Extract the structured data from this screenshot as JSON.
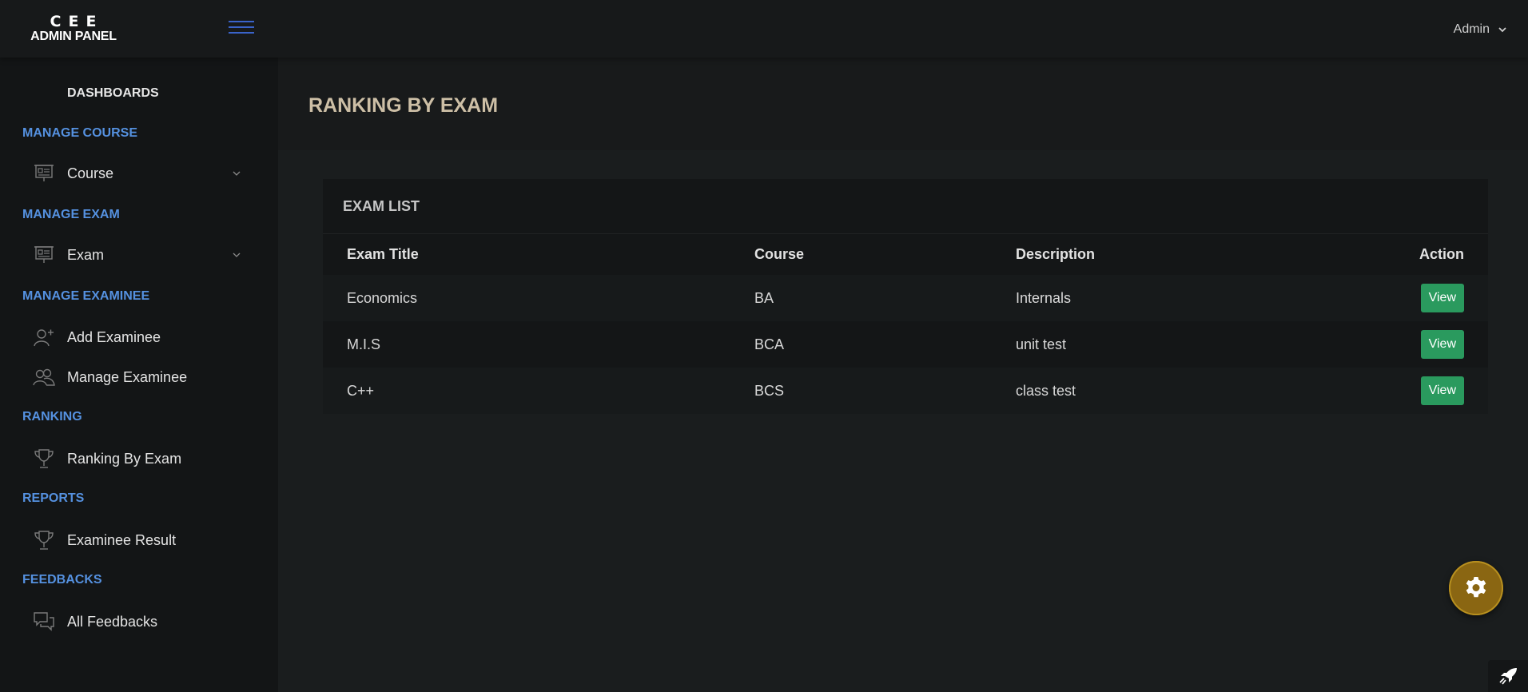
{
  "header": {
    "logo_line1": "CEE",
    "logo_line2": "ADMIN PANEL",
    "user_label": "Admin",
    "menu_icon": "hamburger-icon"
  },
  "sidebar": {
    "dashboards": "DASHBOARDS",
    "sections": {
      "manage_course": "MANAGE COURSE",
      "manage_exam": "MANAGE EXAM",
      "manage_examinee": "MANAGE EXAMINEE",
      "ranking": "RANKING",
      "reports": "REPORTS",
      "feedbacks": "FEEDBACKS"
    },
    "items": {
      "course": "Course",
      "exam": "Exam",
      "add_examinee": "Add Examinee",
      "manage_examinee": "Manage Examinee",
      "ranking_by_exam": "Ranking By Exam",
      "examinee_result": "Examinee Result",
      "all_feedbacks": "All Feedbacks"
    }
  },
  "main": {
    "page_title": "RANKING BY EXAM",
    "card_title": "EXAM LIST",
    "columns": {
      "exam_title": "Exam Title",
      "course": "Course",
      "description": "Description",
      "action": "Action"
    },
    "rows": [
      {
        "title": "Economics",
        "course": "BA",
        "description": "Internals",
        "action": "View"
      },
      {
        "title": "M.I.S",
        "course": "BCA",
        "description": "unit test",
        "action": "View"
      },
      {
        "title": "C++",
        "course": "BCS",
        "description": "class test",
        "action": "View"
      }
    ]
  },
  "colors": {
    "accent_blue": "#5591e0",
    "view_button": "#2a9a5e",
    "fab": "#8a6612"
  }
}
